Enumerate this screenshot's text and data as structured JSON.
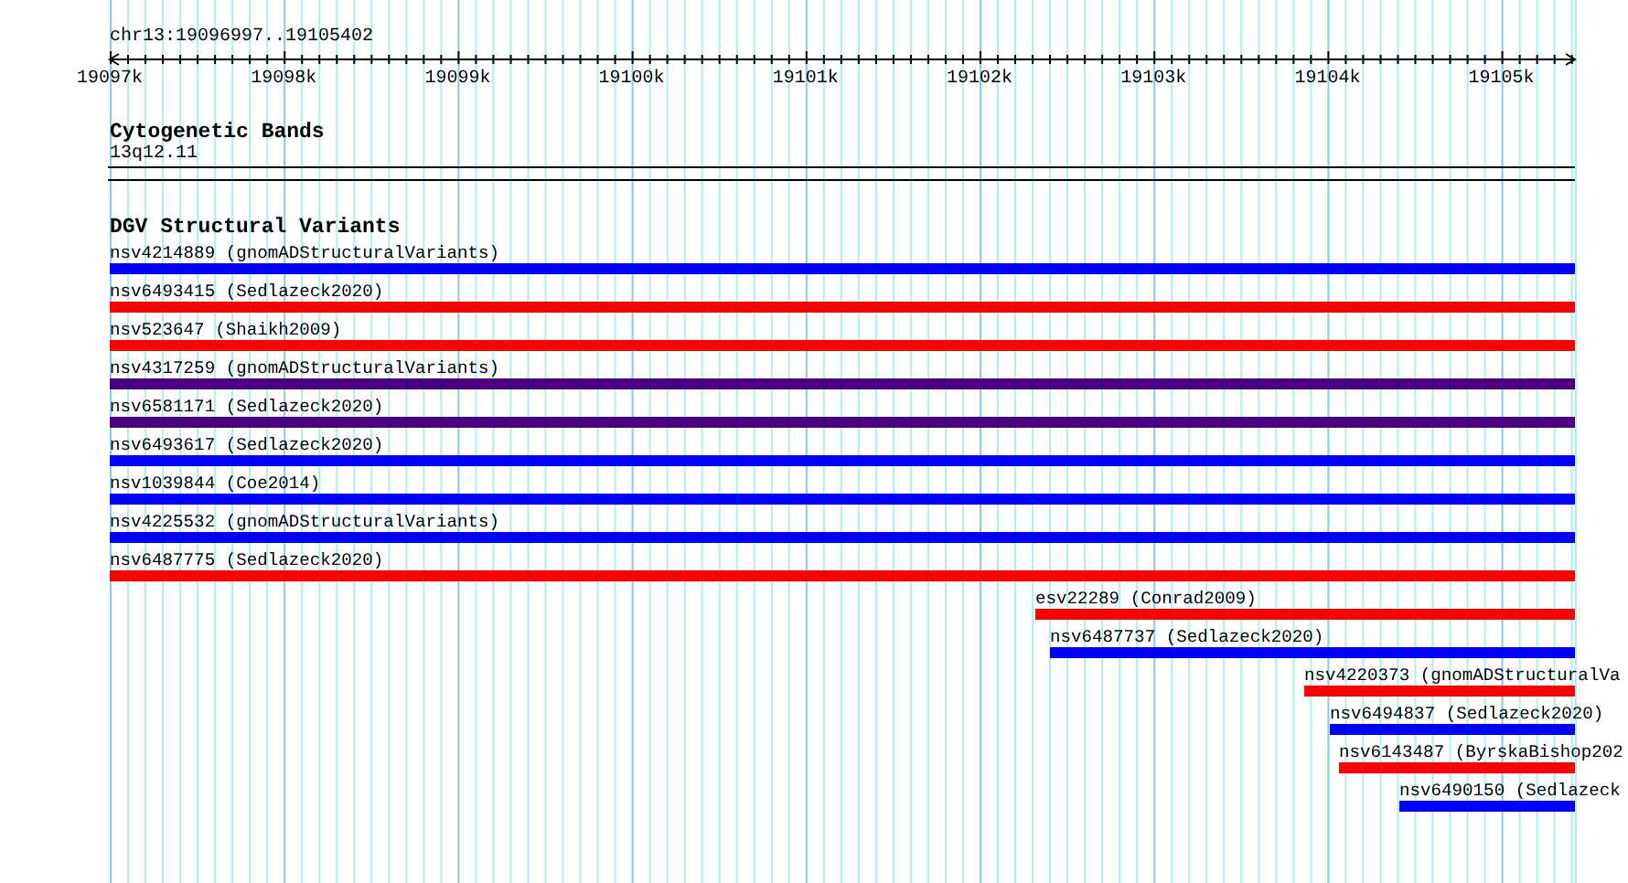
{
  "ruler": {
    "region": "chr13:19096997..19105402",
    "tick_labels": [
      "19097k",
      "19098k",
      "19099k",
      "19100k",
      "19101k",
      "19102k",
      "19103k",
      "19104k",
      "19105k"
    ]
  },
  "cytogenetic_track": {
    "title": "Cytogenetic Bands",
    "band": "13q12.11"
  },
  "dgv_track": {
    "title": "DGV Structural Variants",
    "features": [
      {
        "label": "nsv4214889 (gnomADStructuralVariants)",
        "color": "#0000ff"
      },
      {
        "label": "nsv6493415 (Sedlazeck2020)",
        "color": "#ff0000"
      },
      {
        "label": "nsv523647 (Shaikh2009)",
        "color": "#ff0000"
      },
      {
        "label": "nsv4317259 (gnomADStructuralVariants)",
        "color": "#4b0082"
      },
      {
        "label": "nsv6581171 (Sedlazeck2020)",
        "color": "#4b0082"
      },
      {
        "label": "nsv6493617 (Sedlazeck2020)",
        "color": "#0000ff"
      },
      {
        "label": "nsv1039844 (Coe2014)",
        "color": "#0000ff"
      },
      {
        "label": "nsv4225532 (gnomADStructuralVariants)",
        "color": "#0000ff"
      },
      {
        "label": "nsv6487775 (Sedlazeck2020)",
        "color": "#ff0000"
      },
      {
        "label": "esv22289 (Conrad2009)",
        "color": "#ff0000"
      },
      {
        "label": "nsv6487737 (Sedlazeck2020)",
        "color": "#0000ff"
      },
      {
        "label": "nsv4220373 (gnomADStructuralVa",
        "color": "#ff0000"
      },
      {
        "label": "nsv6494837 (Sedlazeck2020)",
        "color": "#0000ff"
      },
      {
        "label": "nsv6143487 (ByrskaBishop202",
        "color": "#ff0000"
      },
      {
        "label": "nsv6490150 (Sedlazeck",
        "color": "#0000ff"
      }
    ]
  }
}
